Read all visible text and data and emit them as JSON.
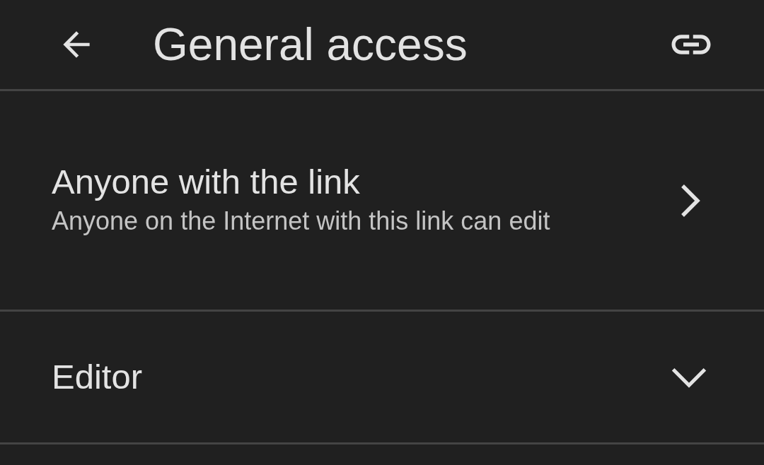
{
  "header": {
    "title": "General access"
  },
  "access": {
    "title": "Anyone with the link",
    "description": "Anyone on the Internet with this link can edit"
  },
  "role": {
    "value": "Editor"
  }
}
